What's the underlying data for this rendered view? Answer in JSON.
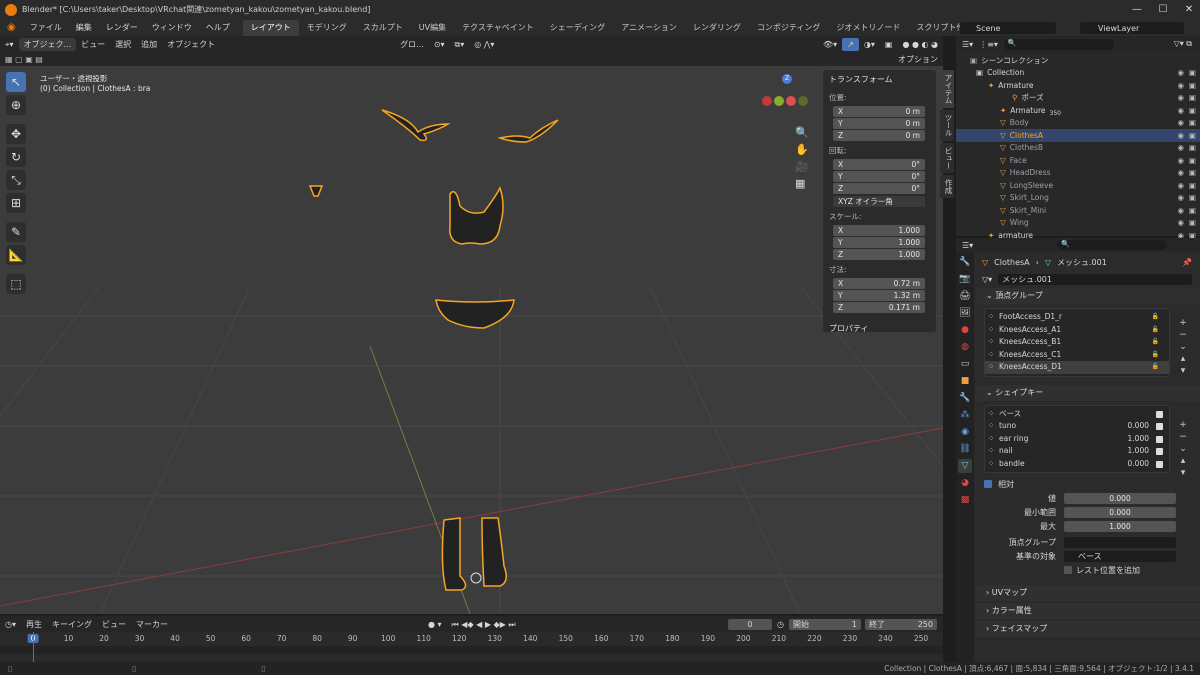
{
  "window": {
    "title": "Blender* [C:\\Users\\taker\\Desktop\\VRchat関連\\zometyan_kakou\\zometyan_kakou.blend]",
    "min": "—",
    "max": "☐",
    "close": "✕"
  },
  "menu": [
    "ファイル",
    "編集",
    "レンダー",
    "ウィンドウ",
    "ヘルプ"
  ],
  "workspaces": [
    "レイアウト",
    "モデリング",
    "スカルプト",
    "UV編集",
    "テクスチャペイント",
    "シェーディング",
    "アニメーション",
    "レンダリング",
    "コンポジティング",
    "ジオメトリノード",
    "スクリプト作成"
  ],
  "active_workspace": "レイアウト",
  "scene_name": "Scene",
  "view_layer": "ViewLayer",
  "viewport_header": {
    "mode": "オブジェク...",
    "items": [
      "ビュー",
      "選択",
      "追加",
      "オブジェクト"
    ],
    "transform": "グロ...",
    "options": "オプション"
  },
  "viewport_overlay": {
    "line1": "ユーザー・透視投影",
    "line2": "(0) Collection | ClothesA : bra"
  },
  "npanel": {
    "title": "トランスフォーム",
    "location_label": "位置:",
    "location": [
      {
        "axis": "X",
        "value": "0 m"
      },
      {
        "axis": "Y",
        "value": "0 m"
      },
      {
        "axis": "Z",
        "value": "0 m"
      }
    ],
    "rotation_label": "回転:",
    "rotation": [
      {
        "axis": "X",
        "value": "0°"
      },
      {
        "axis": "Y",
        "value": "0°"
      },
      {
        "axis": "Z",
        "value": "0°"
      }
    ],
    "rotation_mode": "XYZ オイラー角",
    "scale_label": "スケール:",
    "scale": [
      {
        "axis": "X",
        "value": "1.000"
      },
      {
        "axis": "Y",
        "value": "1.000"
      },
      {
        "axis": "Z",
        "value": "1.000"
      }
    ],
    "dimensions_label": "寸法:",
    "dimensions": [
      {
        "axis": "X",
        "value": "0.72 m"
      },
      {
        "axis": "Y",
        "value": "1.32 m"
      },
      {
        "axis": "Z",
        "value": "0.171 m"
      }
    ],
    "properties": "プロパティ"
  },
  "ntabs": [
    "アイテム",
    "ツール",
    "ビュー",
    "作成"
  ],
  "outliner": {
    "root": "シーンコレクション",
    "rows": [
      {
        "label": "Collection",
        "indent": 1
      },
      {
        "label": "Armature",
        "indent": 2
      },
      {
        "label": "ポーズ",
        "indent": 4
      },
      {
        "label": "Armature",
        "indent": 3,
        "extra": "350"
      },
      {
        "label": "Body",
        "indent": 3
      },
      {
        "label": "ClothesA",
        "indent": 3,
        "selected": true
      },
      {
        "label": "ClothesB",
        "indent": 3
      },
      {
        "label": "Face",
        "indent": 3
      },
      {
        "label": "HeadDress",
        "indent": 3
      },
      {
        "label": "LongSleeve",
        "indent": 3
      },
      {
        "label": "Skirt_Long",
        "indent": 3
      },
      {
        "label": "Skirt_Mini",
        "indent": 3
      },
      {
        "label": "Wing",
        "indent": 3
      },
      {
        "label": "armature",
        "indent": 2
      }
    ]
  },
  "props": {
    "breadcrumb_obj": "ClothesA",
    "breadcrumb_mesh": "メッシュ.001",
    "mesh_name": "メッシュ.001",
    "vgroups_title": "頂点グループ",
    "vgroups": [
      "FootAccess_D1_r",
      "KneesAccess_A1",
      "KneesAccess_B1",
      "KneesAccess_C1",
      "KneesAccess_D1"
    ],
    "shapekeys_title": "シェイプキー",
    "shapekeys": [
      {
        "name": "ベース",
        "value": ""
      },
      {
        "name": "tuno",
        "value": "0.000"
      },
      {
        "name": "ear ring",
        "value": "1.000"
      },
      {
        "name": "nail",
        "value": "1.000"
      },
      {
        "name": "bandle",
        "value": "0.000"
      }
    ],
    "relative_label": "相対",
    "value_label": "値",
    "value": "0.000",
    "min_label": "最小範囲",
    "min": "0.000",
    "max_label": "最大",
    "max": "1.000",
    "vgroup_label": "頂点グループ",
    "ref_label": "基準の対象",
    "ref_value": "ベース",
    "rest_label": "レスト位置を追加",
    "uvmap": "UVマップ",
    "color_attr": "カラー属性",
    "face_map": "フェイスマップ"
  },
  "timeline": {
    "menu": [
      "再生",
      "キーイング",
      "ビュー",
      "マーカー"
    ],
    "current": "0",
    "start_label": "開始",
    "start": "1",
    "end_label": "終了",
    "end": "250",
    "ticks": [
      "0",
      "10",
      "20",
      "30",
      "40",
      "50",
      "60",
      "70",
      "80",
      "90",
      "100",
      "110",
      "120",
      "130",
      "140",
      "150",
      "160",
      "170",
      "180",
      "190",
      "200",
      "210",
      "220",
      "230",
      "240",
      "250"
    ]
  },
  "status": "Collection | ClothesA | 頂点:6,467 | 面:5,834 | 三角面:9,564 | オブジェクト:1/2 | 3.4.1",
  "colors": {
    "accent": "#4772b3",
    "selection": "#f5a623",
    "viewport_bg": "#3c3c3c"
  }
}
